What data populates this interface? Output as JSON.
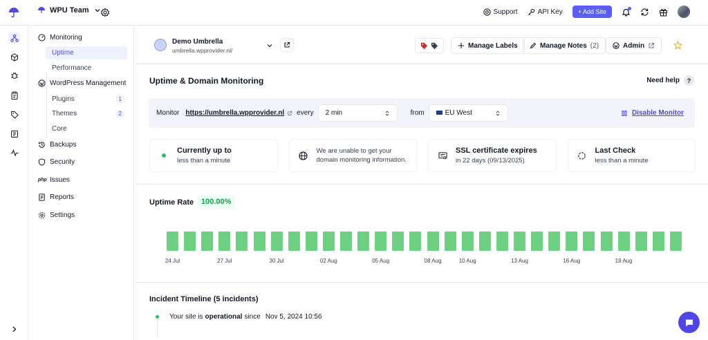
{
  "topbar": {
    "team_name": "WPU Team",
    "support_label": "Support",
    "api_key_label": "API Key",
    "add_site_label": "+ Add Site"
  },
  "icon_rail": [
    "sitemap-icon",
    "cube-icon",
    "bug-icon",
    "clipboard-icon",
    "tag-icon",
    "report-icon",
    "pulse-icon"
  ],
  "sidebar": {
    "monitoring": "Monitoring",
    "uptime": "Uptime",
    "performance": "Performance",
    "wp_management": "WordPress Management",
    "plugins": "Plugins",
    "plugins_count": "1",
    "themes": "Themes",
    "themes_count": "2",
    "core": "Core",
    "backups": "Backups",
    "security": "Security",
    "issues": "Issues",
    "issues_prefix": "php",
    "reports": "Reports",
    "settings": "Settings"
  },
  "site": {
    "name": "Demo Umbrella",
    "url": "umbrella.wpprovider.nl/",
    "manage_labels": "Manage Labels",
    "manage_notes": "Manage Notes",
    "notes_count": "(2)",
    "admin": "Admin"
  },
  "monitoring": {
    "title": "Uptime & Domain Monitoring",
    "need_help": "Need help",
    "help_q": "?",
    "monitor_label": "Monitor",
    "monitor_url": "https://umbrella.wpprovider.nl",
    "every_label": "every",
    "interval": "2 min",
    "from_label": "from",
    "region": "EU West",
    "disable_label": "Disable Monitor"
  },
  "cards": {
    "status_title": "Currently up to",
    "status_sub": "less than a minute",
    "domain_line1": "We are unable to get your",
    "domain_line2": "domain monitoring information.",
    "ssl_title": "SSL certificate expires",
    "ssl_sub": "in 22 days (09/13/2025)",
    "last_check_title": "Last Check",
    "last_check_sub": "less than a minute"
  },
  "uptime": {
    "label": "Uptime Rate",
    "rate": "100.00%"
  },
  "chart_data": {
    "type": "bar",
    "title": "Uptime Rate",
    "categories": [
      "24 Jul",
      "25 Jul",
      "26 Jul",
      "27 Jul",
      "28 Jul",
      "29 Jul",
      "30 Jul",
      "31 Jul",
      "01 Aug",
      "02 Aug",
      "03 Aug",
      "04 Aug",
      "05 Aug",
      "06 Aug",
      "07 Aug",
      "08 Aug",
      "09 Aug",
      "10 Aug",
      "11 Aug",
      "12 Aug",
      "13 Aug",
      "14 Aug",
      "15 Aug",
      "16 Aug",
      "17 Aug",
      "18 Aug",
      "19 Aug",
      "20 Aug",
      "21 Aug",
      "22 Aug"
    ],
    "tick_labels": [
      "24 Jul",
      "27 Jul",
      "30 Jul",
      "02 Aug",
      "05 Aug",
      "08 Aug",
      "10 Aug",
      "13 Aug",
      "16 Aug",
      "19 Aug"
    ],
    "values": [
      100,
      100,
      100,
      100,
      100,
      100,
      100,
      100,
      100,
      100,
      100,
      100,
      100,
      100,
      100,
      100,
      100,
      100,
      100,
      100,
      100,
      100,
      100,
      100,
      100,
      100,
      100,
      100,
      100,
      100
    ],
    "ylim": [
      0,
      100
    ],
    "color": "#6dd083"
  },
  "incidents": {
    "title": "Incident Timeline (5 incidents)",
    "row_prefix": "Your site is",
    "row_status": "operational",
    "row_since": "since",
    "row_date": "Nov 5, 2024 10:56"
  },
  "colors": {
    "accent": "#5b5ef0",
    "green": "#6dd083"
  }
}
